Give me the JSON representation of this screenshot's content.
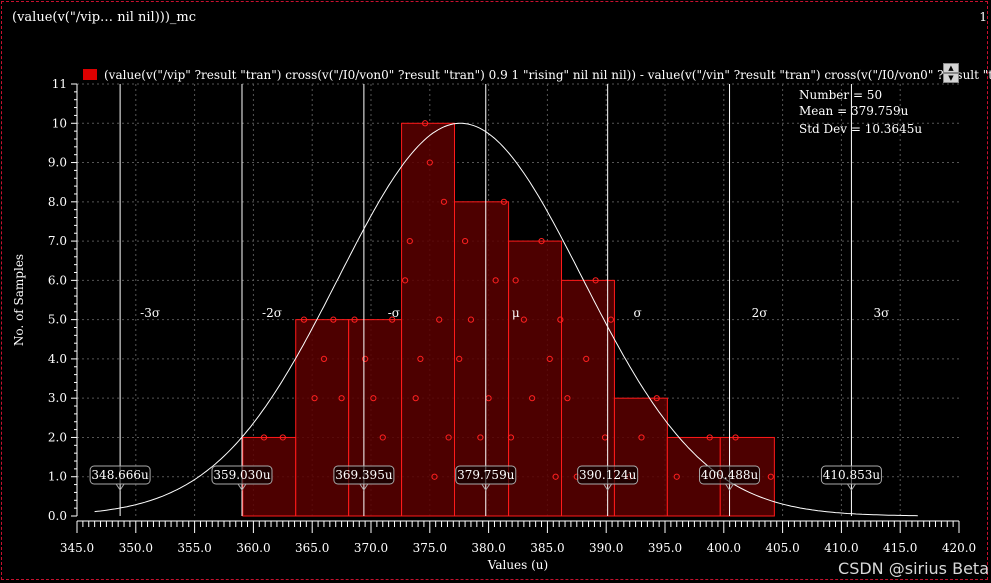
{
  "window": {
    "title": "(value(v(\"/vip… nil nil)))_mc",
    "corner_label": "1",
    "watermark": "CSDN @sirius  Beta"
  },
  "colors": {
    "background": "#000000",
    "bar_fill": "#5a0000",
    "bar_stroke": "#ff1a1a",
    "curve": "#ffffff",
    "sigma_line": "#ffffff",
    "grid": "#555555",
    "frame": "#c8102e"
  },
  "chart_data": {
    "type": "bar",
    "legend": "(value(v(\"/vip\" ?result \"tran\") cross(v(\"/I0/von0\" ?result \"tran\") 0.9 1 \"rising\" nil nil nil)) - value(v(\"/vin\" ?result \"tran\") cross(v(\"/I0/von0\" ?result \"t",
    "xlabel": "Values (u)",
    "ylabel": "No. of Samples",
    "xlim": [
      345.0,
      420.0
    ],
    "ylim": [
      0.0,
      11.0
    ],
    "x_ticks": [
      "345.0",
      "350.0",
      "355.0",
      "360.0",
      "365.0",
      "370.0",
      "375.0",
      "380.0",
      "385.0",
      "390.0",
      "395.0",
      "400.0",
      "405.0",
      "410.0",
      "415.0",
      "420.0"
    ],
    "y_ticks": [
      "0.0",
      "1.0",
      "2.0",
      "3.0",
      "4.0",
      "5.0",
      "6.0",
      "7.0",
      "8.0",
      "9.0",
      "10",
      "11"
    ],
    "bins": [
      {
        "start": 359.1,
        "end": 363.6,
        "count": 2
      },
      {
        "start": 363.6,
        "end": 368.1,
        "count": 5
      },
      {
        "start": 368.1,
        "end": 372.6,
        "count": 5
      },
      {
        "start": 372.6,
        "end": 377.1,
        "count": 10
      },
      {
        "start": 377.1,
        "end": 381.7,
        "count": 8
      },
      {
        "start": 381.7,
        "end": 386.2,
        "count": 7
      },
      {
        "start": 386.2,
        "end": 390.7,
        "count": 6
      },
      {
        "start": 390.7,
        "end": 395.2,
        "count": 3
      },
      {
        "start": 395.2,
        "end": 399.7,
        "count": 2
      },
      {
        "start": 399.7,
        "end": 404.3,
        "count": 2
      }
    ],
    "stats": {
      "number": "Number = 50",
      "mean": "Mean = 379.759u",
      "std_dev": "Std Dev = 10.3645u"
    },
    "sigma_markers": [
      {
        "label": "-3σ",
        "value": 348.666,
        "value_label": "348.666u"
      },
      {
        "label": "-2σ",
        "value": 359.03,
        "value_label": "359.030u"
      },
      {
        "label": "-σ",
        "value": 369.395,
        "value_label": "369.395u"
      },
      {
        "label": "μ",
        "value": 379.759,
        "value_label": "379.759u"
      },
      {
        "label": "σ",
        "value": 390.124,
        "value_label": "390.124u"
      },
      {
        "label": "2σ",
        "value": 400.488,
        "value_label": "400.488u"
      },
      {
        "label": "3σ",
        "value": 410.853,
        "value_label": "410.853u"
      }
    ],
    "curve": {
      "type": "normal",
      "mean": 377.6,
      "sd": 10.3645,
      "peak": 10.0
    },
    "samples": [
      {
        "x": 360.9,
        "y": 2.0
      },
      {
        "x": 362.5,
        "y": 2.0
      },
      {
        "x": 364.3,
        "y": 5.0
      },
      {
        "x": 365.2,
        "y": 3.0
      },
      {
        "x": 366.0,
        "y": 4.0
      },
      {
        "x": 366.8,
        "y": 5.0
      },
      {
        "x": 367.5,
        "y": 3.0
      },
      {
        "x": 368.6,
        "y": 5.0
      },
      {
        "x": 369.5,
        "y": 4.0
      },
      {
        "x": 370.2,
        "y": 3.0
      },
      {
        "x": 371.0,
        "y": 2.0
      },
      {
        "x": 371.8,
        "y": 5.0
      },
      {
        "x": 372.9,
        "y": 6.0
      },
      {
        "x": 373.3,
        "y": 7.0
      },
      {
        "x": 373.8,
        "y": 3.0
      },
      {
        "x": 374.2,
        "y": 4.0
      },
      {
        "x": 374.6,
        "y": 10.0
      },
      {
        "x": 375.0,
        "y": 9.0
      },
      {
        "x": 375.4,
        "y": 1.0
      },
      {
        "x": 375.8,
        "y": 5.0
      },
      {
        "x": 376.2,
        "y": 8.0
      },
      {
        "x": 376.6,
        "y": 2.0
      },
      {
        "x": 377.5,
        "y": 4.0
      },
      {
        "x": 378.0,
        "y": 7.0
      },
      {
        "x": 378.5,
        "y": 5.0
      },
      {
        "x": 379.3,
        "y": 2.0
      },
      {
        "x": 380.0,
        "y": 3.0
      },
      {
        "x": 380.6,
        "y": 6.0
      },
      {
        "x": 381.3,
        "y": 8.0
      },
      {
        "x": 381.9,
        "y": 2.0
      },
      {
        "x": 382.3,
        "y": 6.0
      },
      {
        "x": 383.0,
        "y": 5.0
      },
      {
        "x": 383.7,
        "y": 3.0
      },
      {
        "x": 384.5,
        "y": 7.0
      },
      {
        "x": 385.2,
        "y": 4.0
      },
      {
        "x": 385.7,
        "y": 1.0
      },
      {
        "x": 386.1,
        "y": 5.0
      },
      {
        "x": 386.7,
        "y": 3.0
      },
      {
        "x": 387.5,
        "y": 1.0
      },
      {
        "x": 388.3,
        "y": 4.0
      },
      {
        "x": 389.1,
        "y": 6.0
      },
      {
        "x": 389.9,
        "y": 2.0
      },
      {
        "x": 390.4,
        "y": 5.0
      },
      {
        "x": 392.0,
        "y": 1.0
      },
      {
        "x": 393.0,
        "y": 2.0
      },
      {
        "x": 394.3,
        "y": 3.0
      },
      {
        "x": 396.0,
        "y": 1.0
      },
      {
        "x": 398.8,
        "y": 2.0
      },
      {
        "x": 401.0,
        "y": 2.0
      },
      {
        "x": 404.0,
        "y": 1.0
      }
    ]
  }
}
